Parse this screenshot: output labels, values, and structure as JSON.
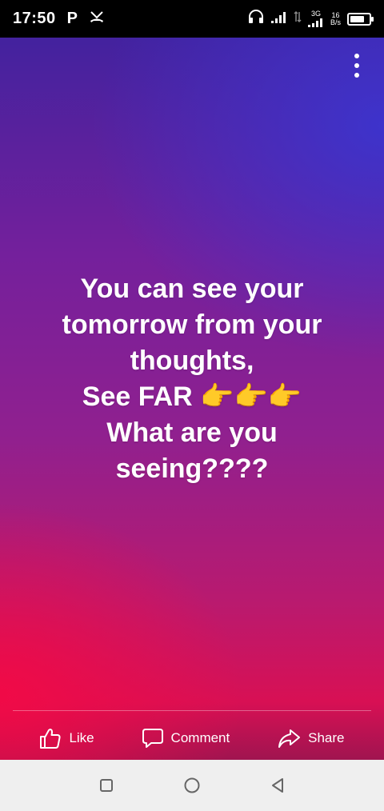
{
  "status_bar": {
    "time": "17:50",
    "app_badge": "P",
    "network_type": "3G",
    "speed_value": "16",
    "speed_unit": "B/s",
    "battery_level": 0.75
  },
  "story": {
    "lines": [
      "You can see your",
      "tomorrow from your",
      "thoughts,",
      "See FAR 👉👉👉",
      "What are you",
      "seeing????"
    ],
    "gradient_colors": [
      "#43229e",
      "#3c34ce",
      "#90208f",
      "#f20a46"
    ]
  },
  "actions": {
    "like": "Like",
    "comment": "Comment",
    "share": "Share"
  },
  "icons": {
    "menu": "more-vertical-icon",
    "like": "thumbs-up-icon",
    "comment": "speech-bubble-icon",
    "share": "share-arrow-icon"
  }
}
